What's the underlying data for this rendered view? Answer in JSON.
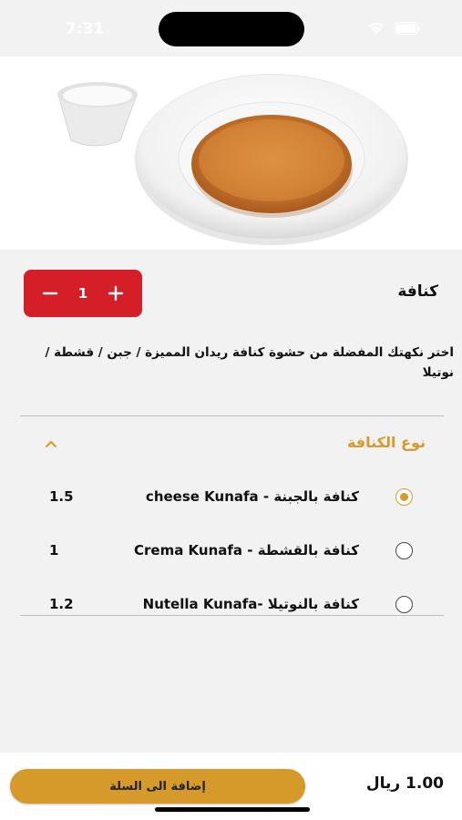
{
  "status_bar": {
    "time": "7:31"
  },
  "product": {
    "name": "كنافة",
    "quantity": "1",
    "description": "اختر نكهتك المفضلة من حشوة كنافة ريدان المميزة / جبن / قشطة / نوتيلا"
  },
  "options_section": {
    "title": "نوع الكنافة",
    "options": [
      {
        "label": "cheese Kunafa - كنافة بالجبنة",
        "price": "1.5",
        "selected": true
      },
      {
        "label": "Crema Kunafa - كنافة بالقشطة",
        "price": "1",
        "selected": false
      },
      {
        "label": "Nutella Kunafa- كنافة بالنوتيلا",
        "price": "1.2",
        "selected": false
      }
    ]
  },
  "footer": {
    "add_to_cart_label": "إضافة الى السلة",
    "total": "1.00 ريال"
  },
  "colors": {
    "accent": "#d59a2a",
    "stepper": "#d41f28"
  }
}
